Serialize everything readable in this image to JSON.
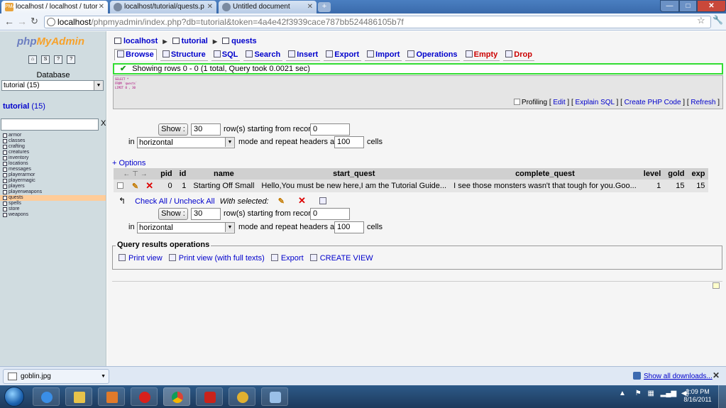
{
  "browser": {
    "tabs": [
      {
        "label": "localhost / localhost / tutor",
        "favicon": "PMA",
        "active": true
      },
      {
        "label": "localhost/tutorial/quests.p",
        "favicon": "",
        "active": false
      },
      {
        "label": "Untitled document",
        "favicon": "",
        "active": false
      }
    ],
    "url_host": "localhost",
    "url_rest": "/phpmyadmin/index.php?db=tutorial&token=4a4e42f3939cace787bb524486105b7f"
  },
  "left": {
    "logo_part1": "php",
    "logo_part2": "MyAdmin",
    "database_label": "Database",
    "database_selected": "tutorial (15)",
    "db_heading_name": "tutorial",
    "db_heading_count": "(15)",
    "filter_clear": "X",
    "tables": [
      "armor",
      "classes",
      "crafting",
      "creatures",
      "inventory",
      "locations",
      "messages",
      "playerarmor",
      "playermagic",
      "players",
      "playerweapons",
      "quests",
      "spells",
      "store",
      "weapons"
    ],
    "active_table": "quests"
  },
  "main": {
    "breadcrumb": {
      "server": "localhost",
      "database": "tutorial",
      "table": "quests"
    },
    "tabs": [
      "Browse",
      "Structure",
      "SQL",
      "Search",
      "Insert",
      "Export",
      "Import",
      "Operations",
      "Empty",
      "Drop"
    ],
    "notice": "Showing rows 0 - 0 (1 total, Query took 0.0021 sec)",
    "sql_lines": [
      "SELECT *",
      "FROM `quests`",
      "LIMIT 0 , 30"
    ],
    "sql_links": {
      "profiling": "Profiling",
      "edit": "Edit",
      "explain": "Explain SQL",
      "php": "Create PHP Code",
      "refresh": "Refresh"
    },
    "nav": {
      "show_label": "Show :",
      "rows_value": "30",
      "starting_label": "row(s) starting from record #",
      "start_value": "0",
      "in_label": "in",
      "mode_value": "horizontal",
      "mode_label": "mode and repeat headers after",
      "repeat_value": "100",
      "cells_label": "cells"
    },
    "options_link": "+ Options",
    "table": {
      "headers": [
        "pid",
        "id",
        "name",
        "start_quest",
        "complete_quest",
        "level",
        "gold",
        "exp"
      ],
      "rows": [
        {
          "pid": "0",
          "id": "1",
          "name": "Starting Off Small",
          "start_quest": "Hello,You must be new here,I am the Tutorial Guide...",
          "complete_quest": "I see those monsters wasn't that tough for you.Goo...",
          "level": "1",
          "gold": "15",
          "exp": "15"
        }
      ]
    },
    "with_selected": {
      "check_all": "Check All / Uncheck All",
      "label": "With selected:"
    },
    "query_ops": {
      "title": "Query results operations",
      "print_view": "Print view",
      "print_full": "Print view (with full texts)",
      "export": "Export",
      "create_view": "CREATE VIEW"
    }
  },
  "downloads": {
    "file": "goblin.jpg",
    "show_all": "Show all downloads...",
    "close": "✕"
  },
  "taskbar": {
    "time": "2:09 PM",
    "date": "8/16/2011"
  },
  "colors": {
    "left_bg": "#d0dce0",
    "link": "#0000cc",
    "notice_border": "#33dd33",
    "active_row": "#ffcc99"
  }
}
